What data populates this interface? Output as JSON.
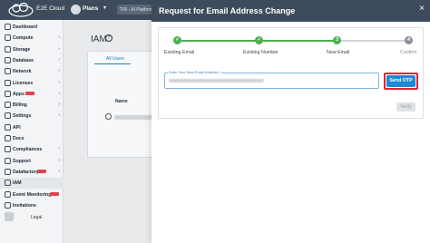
{
  "topbar": {
    "brand": "E2E Cloud",
    "project_label": "Plans",
    "project_caret": "▾",
    "pill_text": "TIR - AI Platform"
  },
  "sidebar": {
    "items": [
      {
        "label": "Dashboard",
        "icon": "dashboard-icon",
        "caret": ""
      },
      {
        "label": "Compute",
        "icon": "compute-icon",
        "caret": "›"
      },
      {
        "label": "Storage",
        "icon": "storage-icon",
        "caret": "›"
      },
      {
        "label": "Database",
        "icon": "database-icon",
        "caret": "›"
      },
      {
        "label": "Network",
        "icon": "network-icon",
        "caret": "›"
      },
      {
        "label": "Licenses",
        "icon": "license-icon",
        "caret": "›"
      },
      {
        "label": "Apps",
        "icon": "apps-icon",
        "caret": "›",
        "badge": true
      },
      {
        "label": "Billing",
        "icon": "billing-icon",
        "caret": "›"
      },
      {
        "label": "Settings",
        "icon": "settings-icon",
        "caret": "›"
      },
      {
        "label": "API",
        "icon": "api-icon",
        "caret": ""
      },
      {
        "label": "Docs",
        "icon": "docs-icon",
        "caret": ""
      },
      {
        "label": "Compliances",
        "icon": "compliance-icon",
        "caret": "›"
      },
      {
        "label": "Support",
        "icon": "support-icon",
        "caret": "›"
      },
      {
        "label": "Datafactory",
        "icon": "datafactory-icon",
        "caret": "›",
        "badge": true
      },
      {
        "label": "IAM",
        "icon": "iam-icon",
        "caret": "",
        "active": true
      },
      {
        "label": "Event Monitoring",
        "icon": "monitoring-icon",
        "caret": "",
        "badge": true
      },
      {
        "label": "Invitations",
        "icon": "invitations-icon",
        "caret": ""
      }
    ],
    "legal": "Legal"
  },
  "background_page": {
    "title": "IAM",
    "help_symbol": "?",
    "tab_all": "All Users",
    "column_name": "Name"
  },
  "modal": {
    "title": "Request for Email Address Change",
    "close_symbol": "×",
    "steps": [
      {
        "label": "Existing Email",
        "status": "done",
        "symbol": "✓"
      },
      {
        "label": "Existing Number",
        "status": "done",
        "symbol": "✓"
      },
      {
        "label": "New Email",
        "status": "current",
        "symbol": "3"
      },
      {
        "label": "Confirm",
        "status": "pending",
        "symbol": "4"
      }
    ],
    "email_field_label": "Enter Your New Email Address *",
    "send_otp_label": "Send OTP",
    "verify_label": "Verify"
  },
  "colors": {
    "header": "#3d4b5c",
    "accent": "#1a8ad6",
    "success": "#4caf50",
    "highlight": "#e0252d"
  }
}
